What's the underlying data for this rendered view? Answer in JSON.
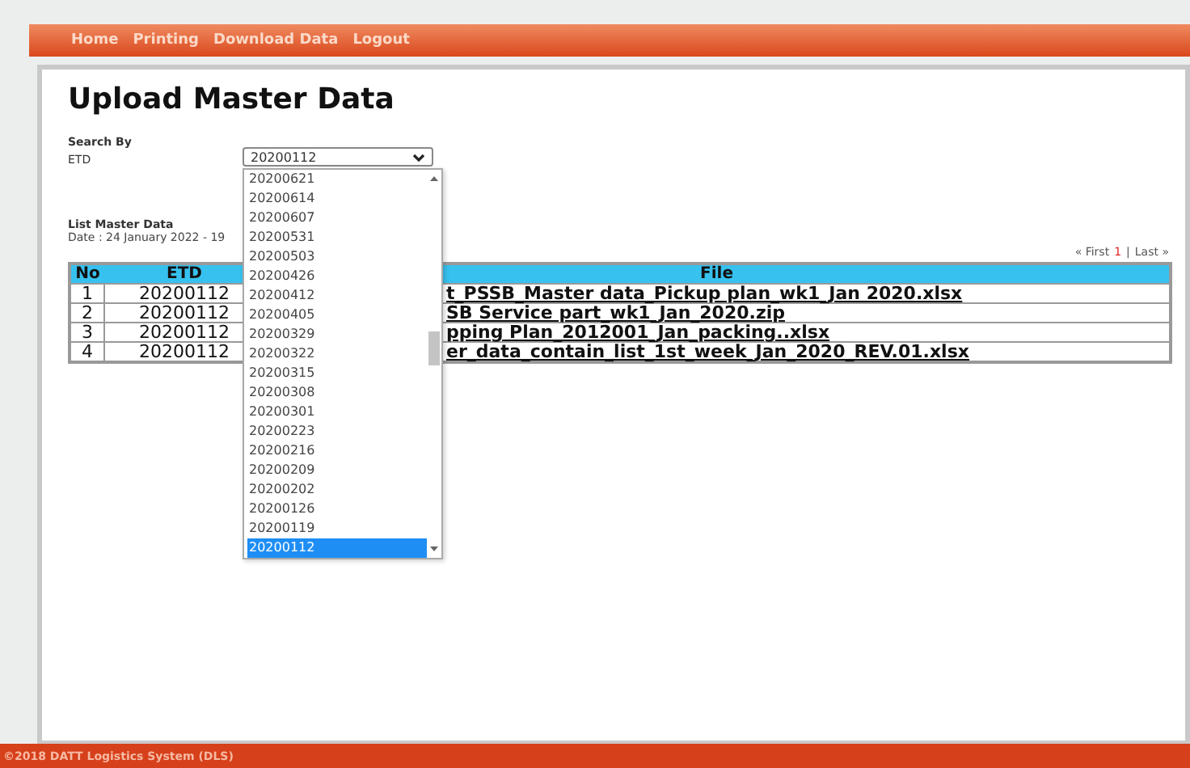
{
  "nav": [
    {
      "label": "Home"
    },
    {
      "label": "Printing"
    },
    {
      "label": "Download Data"
    },
    {
      "label": "Logout"
    }
  ],
  "title": "Upload Master Data",
  "search": {
    "heading": "Search By",
    "label": "ETD",
    "value": "20200112",
    "options": [
      {
        "label": "20200621",
        "selected": false
      },
      {
        "label": "20200614",
        "selected": false
      },
      {
        "label": "20200607",
        "selected": false
      },
      {
        "label": "20200531",
        "selected": false
      },
      {
        "label": "20200503",
        "selected": false
      },
      {
        "label": "20200426",
        "selected": false
      },
      {
        "label": "20200412",
        "selected": false
      },
      {
        "label": "20200405",
        "selected": false
      },
      {
        "label": "20200329",
        "selected": false
      },
      {
        "label": "20200322",
        "selected": false
      },
      {
        "label": "20200315",
        "selected": false
      },
      {
        "label": "20200308",
        "selected": false
      },
      {
        "label": "20200301",
        "selected": false
      },
      {
        "label": "20200223",
        "selected": false
      },
      {
        "label": "20200216",
        "selected": false
      },
      {
        "label": "20200209",
        "selected": false
      },
      {
        "label": "20200202",
        "selected": false
      },
      {
        "label": "20200126",
        "selected": false
      },
      {
        "label": "20200119",
        "selected": false
      },
      {
        "label": "20200112",
        "selected": true
      }
    ]
  },
  "list": {
    "heading": "List Master Data",
    "date": "Date : 24 January 2022 - 19"
  },
  "pagination": {
    "first": "« First",
    "page": "1",
    "separator": "|",
    "last": "Last »"
  },
  "table": {
    "columns": [
      "No",
      "ETD",
      "File"
    ],
    "rows": [
      {
        "no": "1",
        "etd": "20200112",
        "file": "t_PSSB_Master data_Pickup plan_wk1_Jan 2020.xlsx"
      },
      {
        "no": "2",
        "etd": "20200112",
        "file": "SB Service part_wk1_Jan_2020.zip"
      },
      {
        "no": "3",
        "etd": "20200112",
        "file": "pping Plan_2012001_Jan_packing..xlsx"
      },
      {
        "no": "4",
        "etd": "20200112",
        "file": "er_data_contain_list_1st_week_Jan_2020_REV.01.xlsx"
      }
    ]
  },
  "footer": "©2018 DATT Logistics System (DLS)"
}
